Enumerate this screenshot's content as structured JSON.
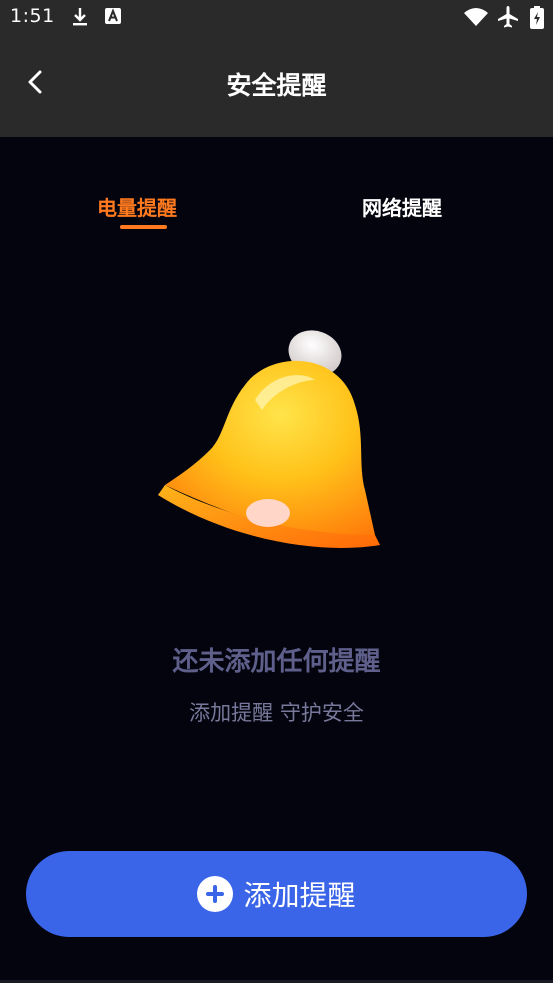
{
  "status_bar": {
    "time": "1:51",
    "left_icons": [
      "download-icon",
      "font-app-icon"
    ],
    "right_icons": [
      "wifi-icon",
      "airplane-mode-icon",
      "battery-icon"
    ]
  },
  "header": {
    "title": "安全提醒",
    "back_icon": "chevron-left-icon"
  },
  "tabs": [
    {
      "label": "电量提醒",
      "active": true
    },
    {
      "label": "网络提醒",
      "active": false
    }
  ],
  "empty_state": {
    "icon": "bell-icon",
    "title": "还未添加任何提醒",
    "subtitle": "添加提醒 守护安全"
  },
  "add_button": {
    "icon": "plus-circle-icon",
    "label": "添加提醒"
  },
  "colors": {
    "accent": "#ff7a1f",
    "button": "#3a65e8",
    "background": "#04040f",
    "bar": "#2a2a2a"
  }
}
